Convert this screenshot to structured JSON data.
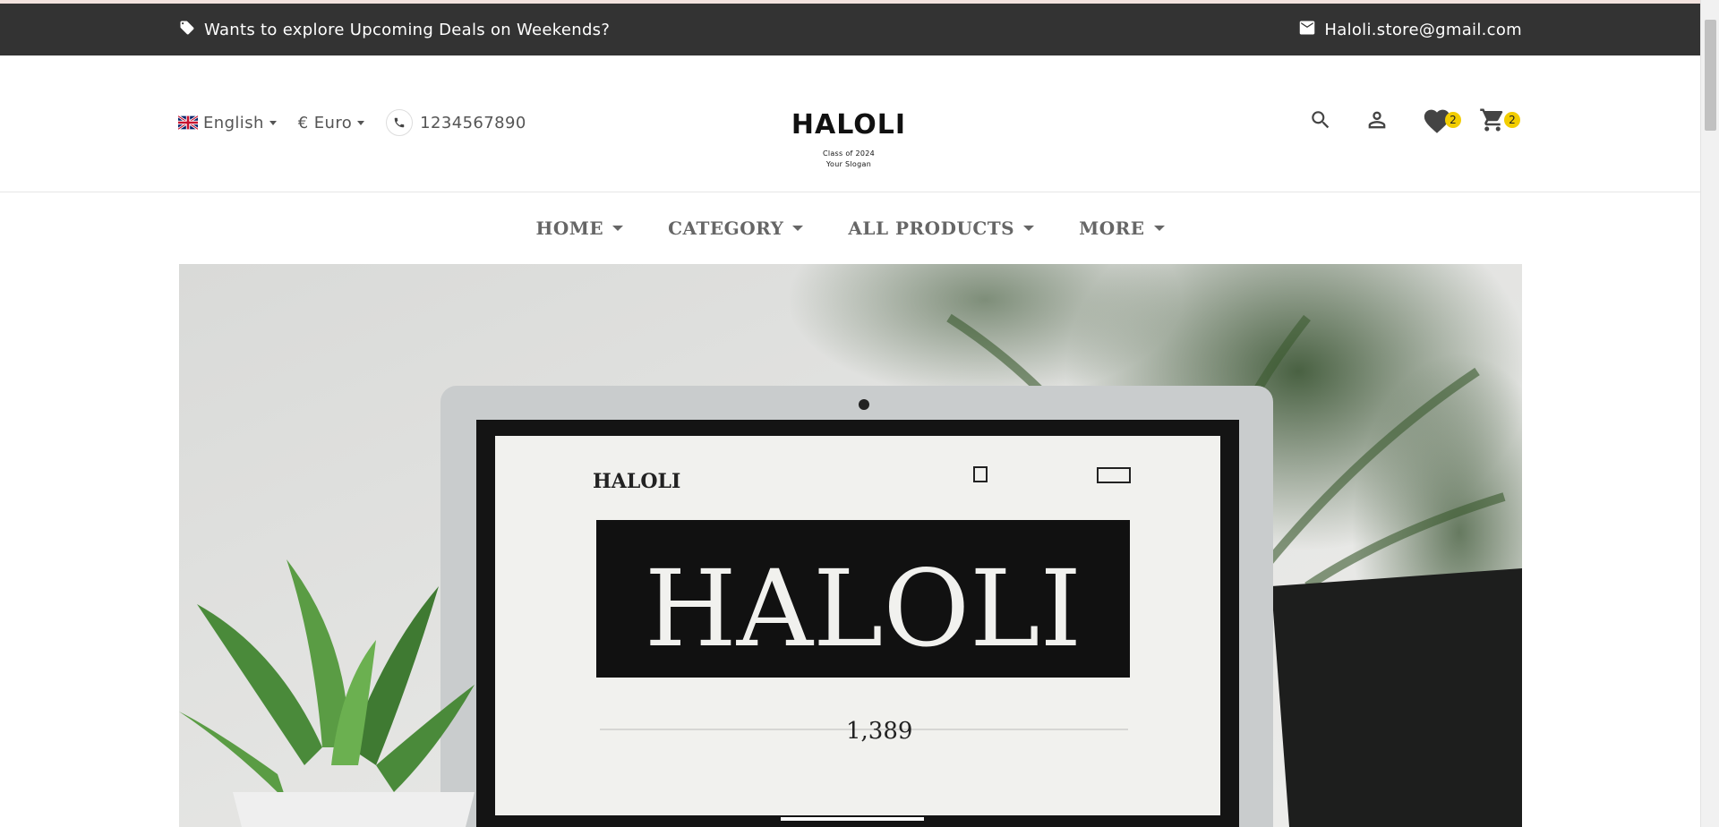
{
  "promo": {
    "message": "Wants to explore Upcoming Deals on Weekends?",
    "email": "Haloli.store@gmail.com",
    "tag_icon": "tag-icon",
    "mail_icon": "mail-icon"
  },
  "header": {
    "language": "English",
    "currency": "€ Euro",
    "phone": "1234567890",
    "logo": {
      "name": "HALOLI",
      "tagline_1": "Class of 2024",
      "tagline_2": "Your Slogan"
    },
    "wishlist_count": "2",
    "cart_count": "2",
    "icons": [
      "search-icon",
      "user-icon",
      "heart-icon",
      "cart-icon"
    ]
  },
  "nav": {
    "items": [
      {
        "label": "HOME"
      },
      {
        "label": "CATEGORY"
      },
      {
        "label": "ALL PRODUCTS"
      },
      {
        "label": "MORE"
      }
    ]
  },
  "hero": {
    "screen_brand": "HALOLI",
    "screen_logo_small": "HALOLI",
    "screen_price": "1,389"
  },
  "colors": {
    "promo_bg": "#333333",
    "badge": "#f2cd00",
    "nav_text": "#666666"
  }
}
